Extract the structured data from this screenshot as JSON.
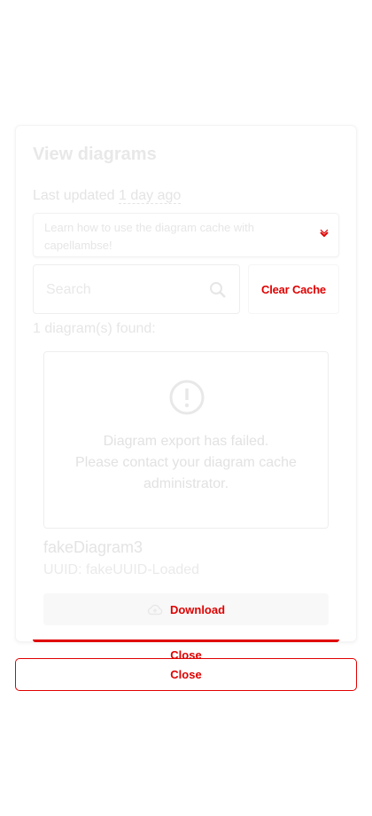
{
  "dialog": {
    "title": "View diagrams",
    "last_updated_prefix": "Last updated",
    "last_updated_relative": "1 day ago"
  },
  "accordion": {
    "text": "Learn how to use the diagram cache with capellambse!",
    "icon": "chevron-down-icon"
  },
  "search": {
    "placeholder": "Search",
    "value": "",
    "icon": "search-icon"
  },
  "clear_cache_label": "Clear Cache",
  "found_text": "1 diagram(s) found:",
  "diagram": {
    "error_icon": "error-icon",
    "error_lines": [
      "Diagram export has failed.",
      "Please contact your diagram cache",
      "administrator."
    ],
    "name": "fakeDiagram3",
    "uuid": "UUID: fakeUUID-Loaded",
    "download_label": "Download",
    "download_icon": "cloud-upload-icon"
  },
  "close_label_top": "Close",
  "close_label": "Close",
  "colors": {
    "accent": "#e00000",
    "muted_text": "#e6e6e6"
  }
}
